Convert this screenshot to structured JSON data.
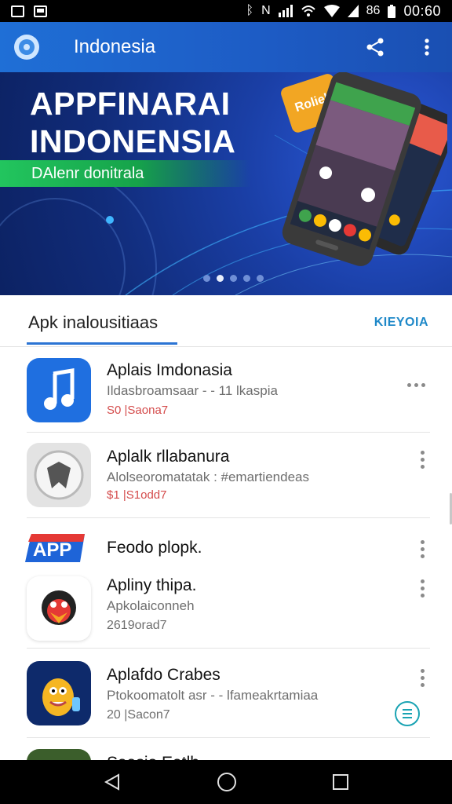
{
  "status_bar": {
    "time": "00:60",
    "network": "86"
  },
  "app_bar": {
    "title": "Indonesia"
  },
  "banner": {
    "title_line1": "APPFINARAI",
    "title_line2": "INDONENSIA",
    "strip_text": "DAlenr donitrala",
    "phone_card_label": "Roliel",
    "carousel": {
      "count": 5,
      "active_index": 1
    }
  },
  "section": {
    "title": "Apk inalousitiaas",
    "action": "KIEYOIA"
  },
  "apps": [
    {
      "name": "Aplais Imdonasia",
      "sub": "Ildasbroamsaar - - 11 lkaspia",
      "meta": "S0 |Saona7",
      "meta_color": "red"
    },
    {
      "name": "Aplalk rllabanura",
      "sub": "Alolseoromatatak : #emartiendeas",
      "meta": "$1 |S1odd7",
      "meta_color": "red"
    },
    {
      "name": "Feodo plopk.",
      "sub": "",
      "meta": "",
      "meta_color": ""
    },
    {
      "name": "Apliny thipa.",
      "sub": "Apkolaiconneh",
      "meta": "2619orad7",
      "meta_color": "grey"
    },
    {
      "name": "Aplafdo Crabes",
      "sub": "Ptokoomatolt asr - - lfameakrtamiaa",
      "meta": "20 |Sacon7",
      "meta_color": "grey"
    },
    {
      "name": "Saasio Eatlh",
      "sub": "",
      "meta": "",
      "meta_color": ""
    }
  ],
  "icons": {
    "app_logo": "compass-logo-icon",
    "share": "share-icon",
    "overflow": "more-vert-icon",
    "nav_back": "back-triangle-icon",
    "nav_home": "home-circle-icon",
    "nav_recent": "recent-square-icon"
  },
  "colors": {
    "app_bar": "#1d5bc4",
    "banner_bg": "#112c7a",
    "accent_green": "#16a34a",
    "accent_blue": "#2b74d4",
    "price_red": "#d44b4b",
    "link_teal": "#1e88c8"
  }
}
